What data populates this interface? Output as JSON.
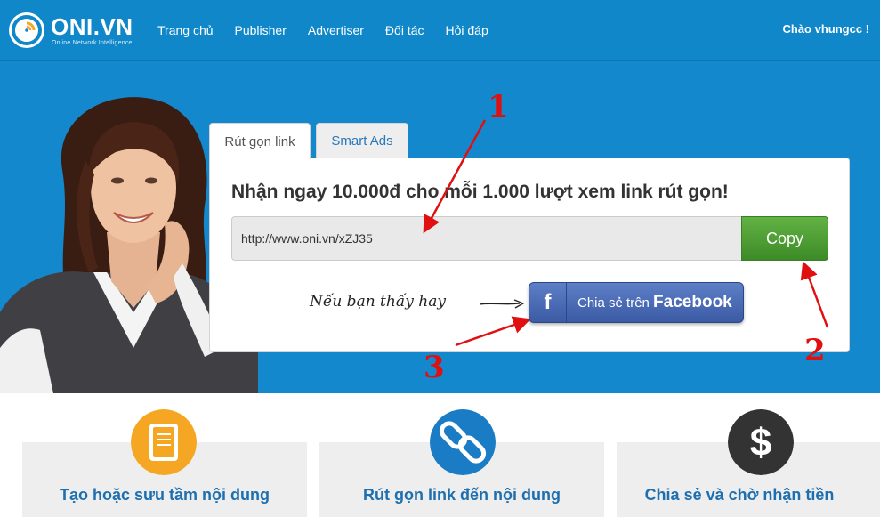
{
  "header": {
    "logo_name": "ONI.VN",
    "logo_tagline": "Online Network Intelligence",
    "nav": [
      {
        "label": "Trang chủ"
      },
      {
        "label": "Publisher"
      },
      {
        "label": "Advertiser"
      },
      {
        "label": "Đối tác"
      },
      {
        "label": "Hỏi đáp"
      }
    ],
    "greeting": "Chào vhungcc !"
  },
  "tabs": [
    {
      "label": "Rút gọn link",
      "active": true
    },
    {
      "label": "Smart Ads",
      "active": false
    }
  ],
  "card": {
    "title": "Nhận ngay 10.000đ cho mỗi 1.000 lượt xem link rút gọn!",
    "short_url": "http://www.oni.vn/xZJ35",
    "copy_label": "Copy",
    "share_hint": "Nếu bạn thấy hay",
    "share_prefix": "Chia sẻ trên",
    "share_brand": "Facebook",
    "facebook_icon": "f"
  },
  "annotations": [
    "1",
    "2",
    "3"
  ],
  "features": [
    {
      "label": "Tạo hoặc sưu tầm nội dung",
      "icon": "document-icon",
      "color": "#f5a623"
    },
    {
      "label": "Rút gọn link đến nội dung",
      "icon": "chain-link-icon",
      "color": "#1a7cc5"
    },
    {
      "label": "Chia sẻ và chờ nhận tiền",
      "icon": "dollar-icon",
      "color": "#333333"
    }
  ],
  "colors": {
    "header_bg": "#0f87c9",
    "hero_bg": "#1488cd",
    "copy_button": "#4fa236",
    "facebook_button": "#4a69b3",
    "annotation": "#e01010",
    "feature_text": "#1e6fb0"
  }
}
